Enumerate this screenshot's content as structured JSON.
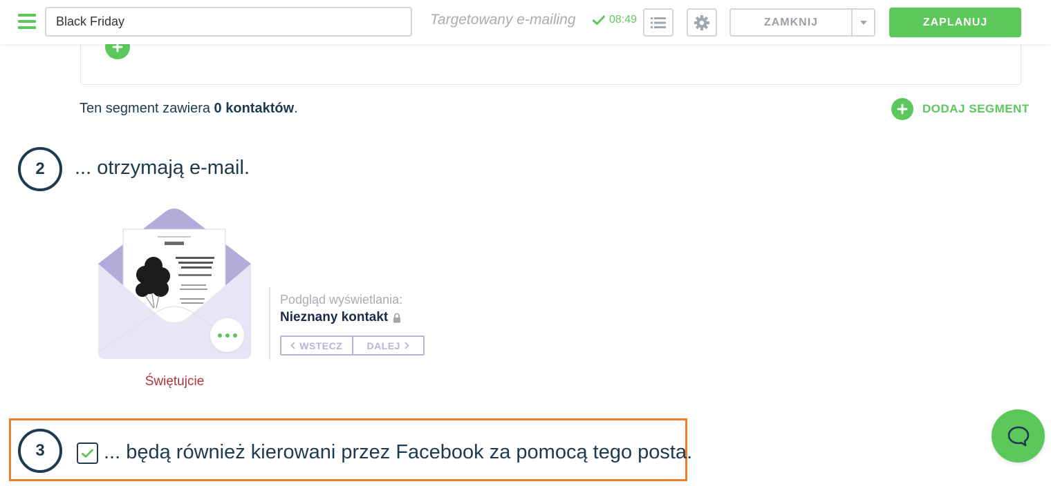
{
  "header": {
    "campaign_name": "Black Friday",
    "campaign_type": "Targetowany e-mailing",
    "save_time": "08:49",
    "close_label": "ZAMKNIJ",
    "schedule_label": "ZAPLANUJ"
  },
  "segment": {
    "count_prefix": "Ten segment zawiera ",
    "count_value": "0 kontaktów",
    "count_suffix": ".",
    "add_segment_label": "DODAJ SEGMENT"
  },
  "step2": {
    "number": "2",
    "title": "... otrzymają e-mail.",
    "email_name": "Świętujcie",
    "preview_label": "Podgląd wyświetlania:",
    "preview_contact": "Nieznany kontakt",
    "prev_label": "WSTECZ",
    "next_label": "DALEJ"
  },
  "step3": {
    "number": "3",
    "title": "... będą również kierowani przez Facebook za pomocą tego posta.",
    "checked": true
  },
  "colors": {
    "accent_green": "#5cc85c",
    "dark_navy": "#1d3a4f",
    "highlight_orange": "#f07f2d",
    "email_name_red": "#b0343a",
    "envelope_lavender": "#b1acd9"
  },
  "icons": {
    "menu": "hamburger-menu-icon",
    "saved": "checkmark-icon",
    "list": "list-icon",
    "settings": "gear-icon",
    "dropdown": "caret-down-icon",
    "add": "plus-icon",
    "lock": "lock-icon",
    "chat": "chat-bubble-icon"
  }
}
